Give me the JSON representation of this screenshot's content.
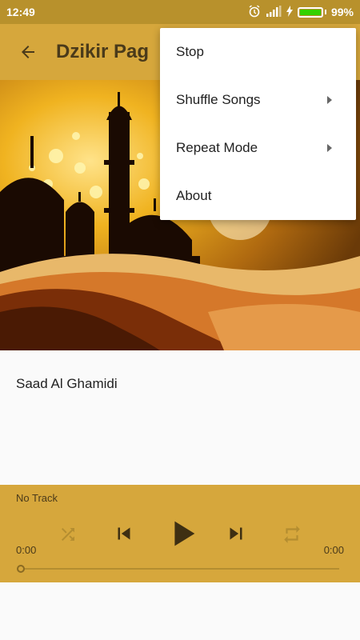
{
  "status_bar": {
    "time": "12:49",
    "battery_percent": "99%",
    "battery_level": 0.99,
    "icons": [
      "alarm-icon",
      "signal-icon",
      "charging-icon",
      "battery-icon"
    ]
  },
  "app_bar": {
    "title": "Dzikir Pag",
    "back_icon": "arrow-back-icon"
  },
  "content": {
    "reciter_name": "Saad Al Ghamidi"
  },
  "player": {
    "track_name": "No Track",
    "elapsed": "0:00",
    "duration": "0:00",
    "progress": 0,
    "controls": [
      "shuffle-icon",
      "skip-previous-icon",
      "play-icon",
      "skip-next-icon",
      "repeat-icon"
    ]
  },
  "overflow_menu": {
    "items": [
      {
        "label": "Stop",
        "has_submenu": false
      },
      {
        "label": "Shuffle Songs",
        "has_submenu": true
      },
      {
        "label": "Repeat Mode",
        "has_submenu": true
      },
      {
        "label": "About",
        "has_submenu": false
      }
    ]
  },
  "colors": {
    "status_bar": "#b8912c",
    "app_bar": "#d6a73c",
    "player": "#d6a73c",
    "text_dark": "#4a3a1a"
  }
}
